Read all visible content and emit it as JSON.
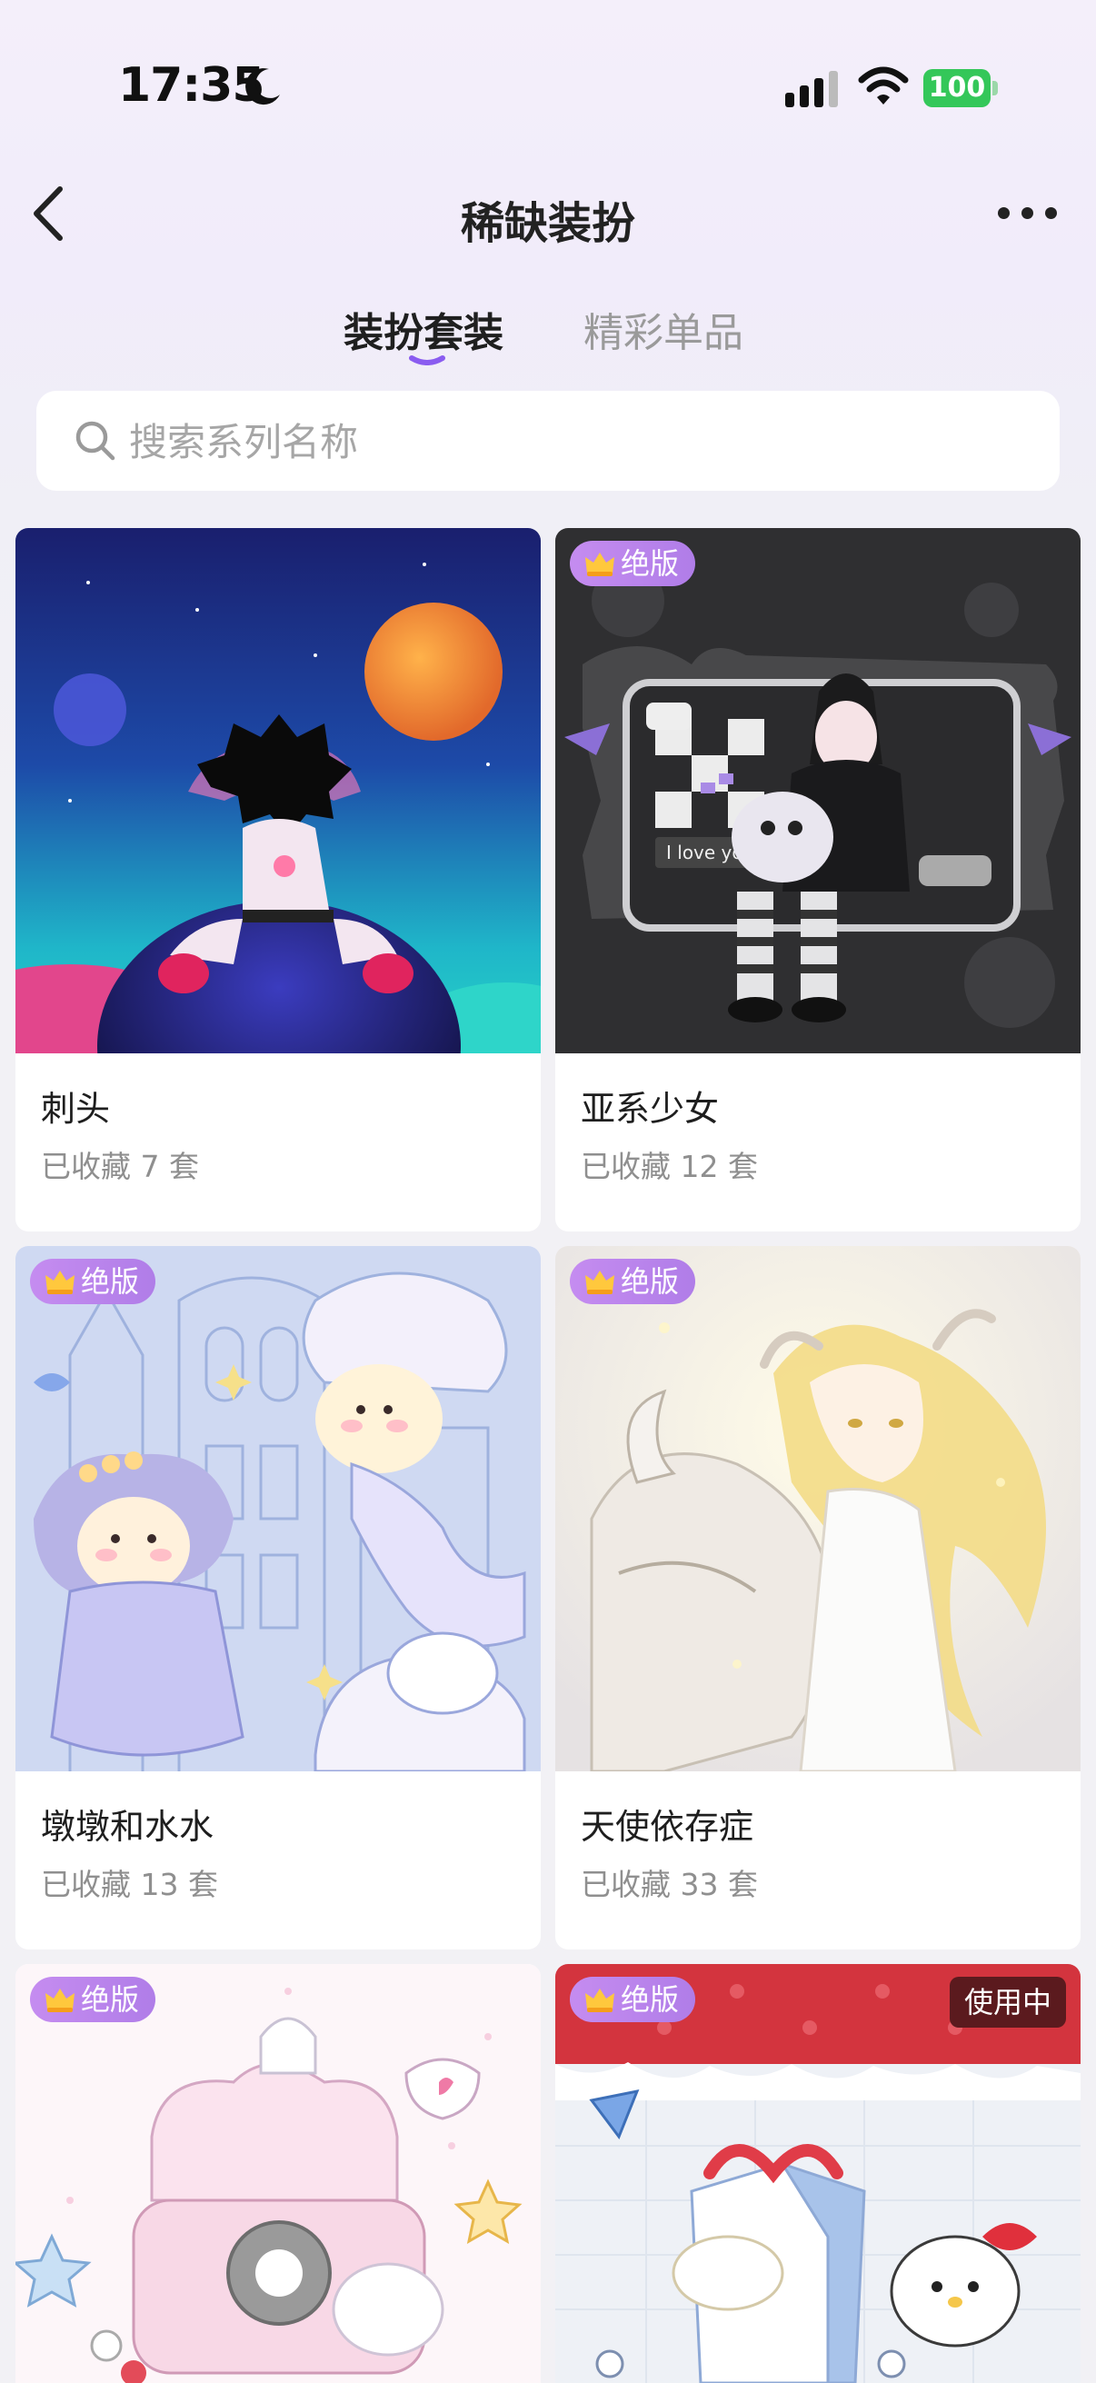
{
  "status_bar": {
    "time": "17:35",
    "battery": "100"
  },
  "nav": {
    "title": "稀缺装扮"
  },
  "tabs": [
    {
      "label": "装扮套装",
      "active": true
    },
    {
      "label": "精彩单品",
      "active": false
    }
  ],
  "search": {
    "placeholder": "搜索系列名称"
  },
  "badges": {
    "discontinued": "绝版",
    "in_use": "使用中"
  },
  "cards": [
    {
      "name": "刺头",
      "collected": "已收藏 7 套",
      "badge": false,
      "in_use": false
    },
    {
      "name": "亚系少女",
      "collected": "已收藏 12 套",
      "badge": true,
      "in_use": false
    },
    {
      "name": "墩墩和水水",
      "collected": "已收藏 13 套",
      "badge": true,
      "in_use": false
    },
    {
      "name": "天使依存症",
      "collected": "已收藏 33 套",
      "badge": true,
      "in_use": false
    },
    {
      "name": "",
      "collected": "",
      "badge": true,
      "in_use": false
    },
    {
      "name": "",
      "collected": "",
      "badge": true,
      "in_use": true
    }
  ],
  "colors": {
    "accent": "#8a5cf0",
    "badge": "#b784ee",
    "battery": "#34c759",
    "in_use_bg": "#5b1a1e"
  },
  "icons": [
    "moon-icon",
    "signal-icon",
    "wifi-icon",
    "back-icon",
    "more-icon",
    "search-icon",
    "crown-icon"
  ]
}
